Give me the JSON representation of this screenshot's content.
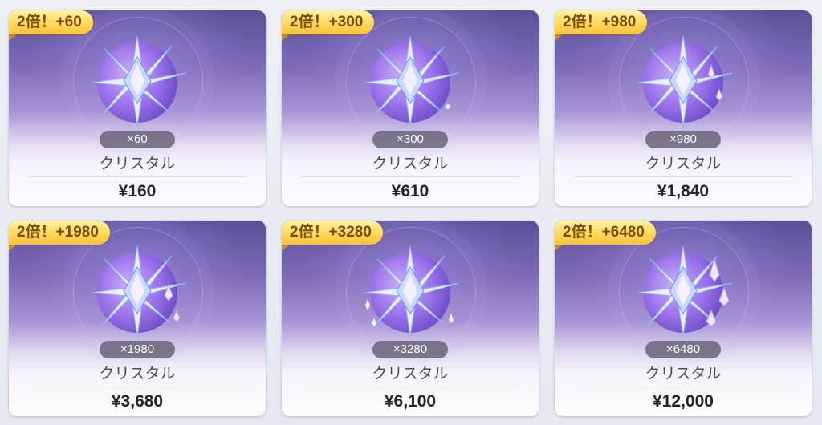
{
  "products": [
    {
      "badge": "2倍！+60",
      "quantity": "×60",
      "name": "クリスタル",
      "price": "¥160",
      "icon": "crystal-icon"
    },
    {
      "badge": "2倍！+300",
      "quantity": "×300",
      "name": "クリスタル",
      "price": "¥610",
      "icon": "crystal-icon"
    },
    {
      "badge": "2倍！+980",
      "quantity": "×980",
      "name": "クリスタル",
      "price": "¥1,840",
      "icon": "crystal-icon"
    },
    {
      "badge": "2倍！+1980",
      "quantity": "×1980",
      "name": "クリスタル",
      "price": "¥3,680",
      "icon": "crystal-icon"
    },
    {
      "badge": "2倍！+3280",
      "quantity": "×3280",
      "name": "クリスタル",
      "price": "¥6,100",
      "icon": "crystal-icon"
    },
    {
      "badge": "2倍！+6480",
      "quantity": "×6480",
      "name": "クリスタル",
      "price": "¥12,000",
      "icon": "crystal-icon"
    }
  ],
  "colors": {
    "badge_gold": "#ffd95a",
    "badge_text": "#7a4a12",
    "card_top": "#5c4f99",
    "quantity_pill": "#5f5a6e"
  }
}
